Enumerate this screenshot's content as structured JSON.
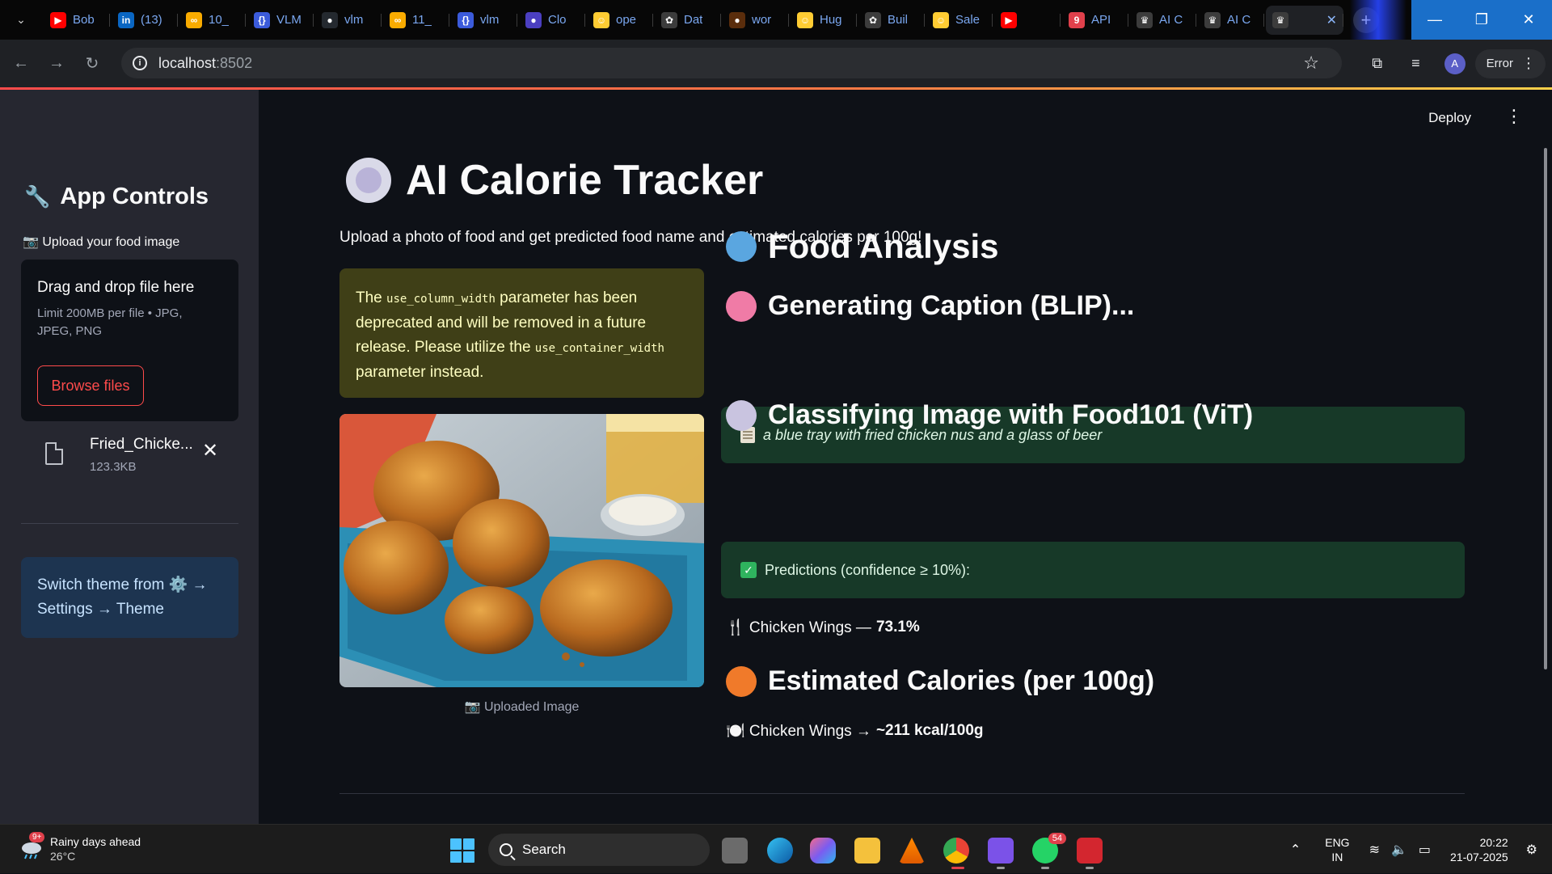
{
  "browser": {
    "tabs": [
      {
        "label": "Bob",
        "icon": "youtube-icon",
        "color": "#ff0000",
        "glyph": "▶"
      },
      {
        "label": "(13)",
        "icon": "linkedin-icon",
        "color": "#0a66c2",
        "glyph": "in"
      },
      {
        "label": "10_",
        "icon": "colab-icon",
        "color": "#f9ab00",
        "glyph": "∞"
      },
      {
        "label": "VLM",
        "icon": "code-brackets-icon",
        "color": "#3b5bdb",
        "glyph": "{}"
      },
      {
        "label": "vlm",
        "icon": "github-icon",
        "color": "#24292f",
        "glyph": "●"
      },
      {
        "label": "11_",
        "icon": "colab-icon",
        "color": "#f9ab00",
        "glyph": "∞"
      },
      {
        "label": "vlm",
        "icon": "code-brackets-icon",
        "color": "#3b5bdb",
        "glyph": "{}"
      },
      {
        "label": "Clo",
        "icon": "claude-icon",
        "color": "#4b3fc0",
        "glyph": "●"
      },
      {
        "label": "ope",
        "icon": "huggingface-icon",
        "color": "#ffcc33",
        "glyph": "☺"
      },
      {
        "label": "Dat",
        "icon": "openai-icon",
        "color": "#3c3c3c",
        "glyph": "✿"
      },
      {
        "label": "wor",
        "icon": "streamlit-icon",
        "color": "#5a2d0c",
        "glyph": "●"
      },
      {
        "label": "Hug",
        "icon": "huggingface-icon",
        "color": "#ffcc33",
        "glyph": "☺"
      },
      {
        "label": "Buil",
        "icon": "openai-icon",
        "color": "#3c3c3c",
        "glyph": "✿"
      },
      {
        "label": "Sale",
        "icon": "huggingface-icon",
        "color": "#ffcc33",
        "glyph": "☺"
      },
      {
        "label": "",
        "icon": "youtube-icon",
        "color": "#ff0000",
        "glyph": "▶"
      },
      {
        "label": "API",
        "icon": "api-icon",
        "color": "#e0404b",
        "glyph": "9"
      },
      {
        "label": "AI C",
        "icon": "crown-icon",
        "color": "#3c3c3c",
        "glyph": "♛"
      },
      {
        "label": "AI C",
        "icon": "crown-icon",
        "color": "#3c3c3c",
        "glyph": "♛"
      },
      {
        "label": "",
        "icon": "crown-icon",
        "color": "#3c3c3c",
        "glyph": "♛",
        "active": true
      }
    ],
    "url_host": "localhost",
    "url_port": ":8502",
    "error_label": "Error",
    "profile_initial": "A"
  },
  "sidebar": {
    "title": "App Controls",
    "upload_label": "📷 Upload your food image",
    "dropzone_title": "Drag and drop file here",
    "dropzone_limit": "Limit 200MB per file • JPG, JPEG, PNG",
    "browse_label": "Browse files",
    "file_name": "Fried_Chicke...",
    "file_size": "123.3KB",
    "theme_line1": "Switch theme from ⚙️ →",
    "theme_line2": "Settings → Theme"
  },
  "main": {
    "deploy_label": "Deploy",
    "title": "AI Calorie Tracker",
    "subtitle": "Upload a photo of food and get predicted food name and estimated calories per 100g!",
    "warning": {
      "pre": "The ",
      "code1": "use_column_width",
      "mid": " parameter has been deprecated and will be removed in a future release. Please utilize the ",
      "code2": "use_container_width",
      "post": " parameter instead."
    },
    "image_caption": "📷 Uploaded Image",
    "analysis_heading": "Food Analysis",
    "caption_heading": "Generating Caption (BLIP)...",
    "caption_text": "a blue tray with fried chicken nus and a glass of beer",
    "classify_heading": "Classifying Image with Food101 (ViT)",
    "predictions_label": "Predictions (confidence ≥ 10%):",
    "prediction_name": "🍴 Chicken Wings —",
    "prediction_conf": "73.1%",
    "calories_heading": "Estimated Calories (per 100g)",
    "calories_name": "🍽️ Chicken Wings →",
    "calories_value": "~211 kcal/100g"
  },
  "taskbar": {
    "weather_text": "Rainy days ahead",
    "weather_temp": "26°C",
    "weather_badge": "9+",
    "search_label": "Search",
    "whatsapp_badge": "54",
    "lang_line1": "ENG",
    "lang_line2": "IN",
    "time": "20:22",
    "date": "21-07-2025"
  },
  "colors": {
    "accent_red": "#ff4b4b",
    "success_bg": "#173928",
    "warning_bg": "#3f3f17",
    "info_bg": "#1d3450"
  }
}
